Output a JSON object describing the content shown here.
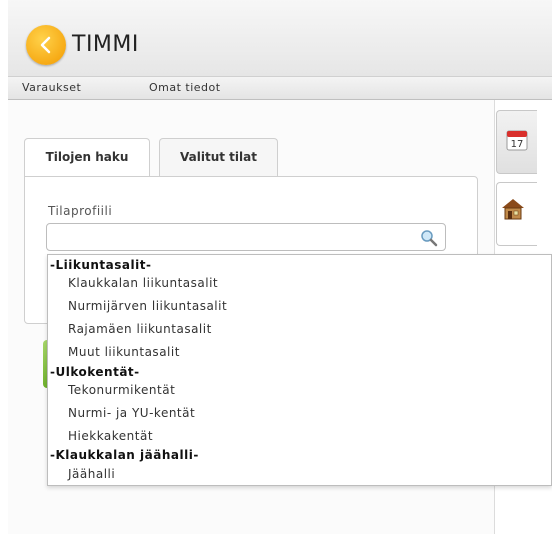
{
  "app": {
    "title": "TIMMI"
  },
  "menu": [
    "Varaukset",
    "Omat tiedot"
  ],
  "tabs": [
    {
      "label": "Tilojen haku",
      "active": true
    },
    {
      "label": "Valitut tilat",
      "active": false
    }
  ],
  "field": {
    "label": "Tilaprofiili",
    "value": ""
  },
  "sidebar": {
    "calendar_day": "17"
  },
  "dropdown": {
    "groups": [
      {
        "label": "-Liikuntasalit-",
        "options": [
          "Klaukkalan liikuntasalit",
          "Nurmijärven liikuntasalit",
          "Rajamäen liikuntasalit",
          "Muut liikuntasalit"
        ]
      },
      {
        "label": "-Ulkokentät-",
        "options": [
          "Tekonurmikentät",
          "Nurmi- ja YU-kentät",
          "Hiekkakentät"
        ]
      },
      {
        "label": "-Klaukkalan jäähalli-",
        "options": [
          "Jäähalli"
        ]
      }
    ]
  },
  "colors": {
    "brand_orange": "#f39a00",
    "accent_green": "#6fb12c"
  }
}
